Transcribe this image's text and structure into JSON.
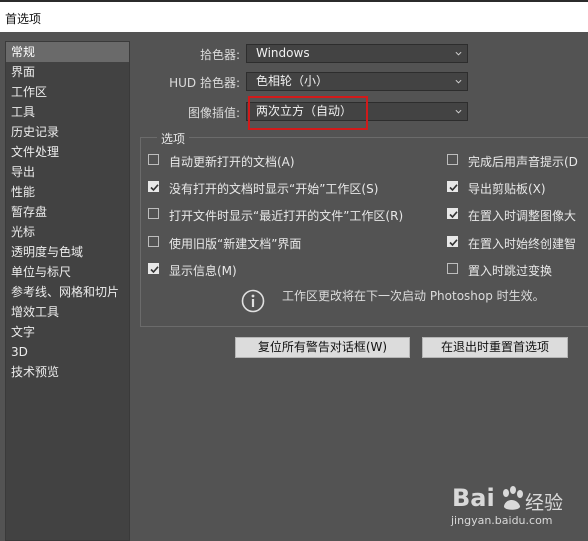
{
  "window": {
    "title": "首选项"
  },
  "sidebar": {
    "items": [
      {
        "label": "常规",
        "active": true
      },
      {
        "label": "界面"
      },
      {
        "label": "工作区"
      },
      {
        "label": "工具"
      },
      {
        "label": "历史记录"
      },
      {
        "label": "文件处理"
      },
      {
        "label": "导出"
      },
      {
        "label": "性能"
      },
      {
        "label": "暂存盘"
      },
      {
        "label": "光标"
      },
      {
        "label": "透明度与色域"
      },
      {
        "label": "单位与标尺"
      },
      {
        "label": "参考线、网格和切片"
      },
      {
        "label": "增效工具"
      },
      {
        "label": "文字"
      },
      {
        "label": "3D"
      },
      {
        "label": "技术预览"
      }
    ]
  },
  "form": {
    "color_picker": {
      "label": "拾色器:",
      "value": "Windows"
    },
    "hud_color_picker": {
      "label": "HUD 拾色器:",
      "value": "色相轮（小）"
    },
    "image_interpolation": {
      "label": "图像插值:",
      "value": "两次立方（自动）"
    }
  },
  "options": {
    "title": "选项",
    "left": [
      {
        "label": "自动更新打开的文档(A)",
        "checked": false
      },
      {
        "label": "没有打开的文档时显示“开始”工作区(S)",
        "checked": true
      },
      {
        "label": "打开文件时显示“最近打开的文件”工作区(R)",
        "checked": false
      },
      {
        "label": "使用旧版“新建文档”界面",
        "checked": false
      },
      {
        "label": "显示信息(M)",
        "checked": true
      }
    ],
    "right": [
      {
        "label": "完成后用声音提示(D",
        "checked": false
      },
      {
        "label": "导出剪贴板(X)",
        "checked": true
      },
      {
        "label": "在置入时调整图像大",
        "checked": true
      },
      {
        "label": "在置入时始终创建智",
        "checked": true
      },
      {
        "label": "置入时跳过变换",
        "checked": false
      }
    ],
    "info_text": "工作区更改将在下一次启动 Photoshop 时生效。"
  },
  "buttons": {
    "reset_warnings": "复位所有警告对话框(W)",
    "reset_prefs": "在退出时重置首选项"
  },
  "watermark": {
    "logo": "Bai",
    "logo2": "经验",
    "url": "jingyan.baidu.com"
  },
  "colors": {
    "background": "#535353",
    "sidebar": "#424242",
    "highlight": "#d11a1a"
  }
}
